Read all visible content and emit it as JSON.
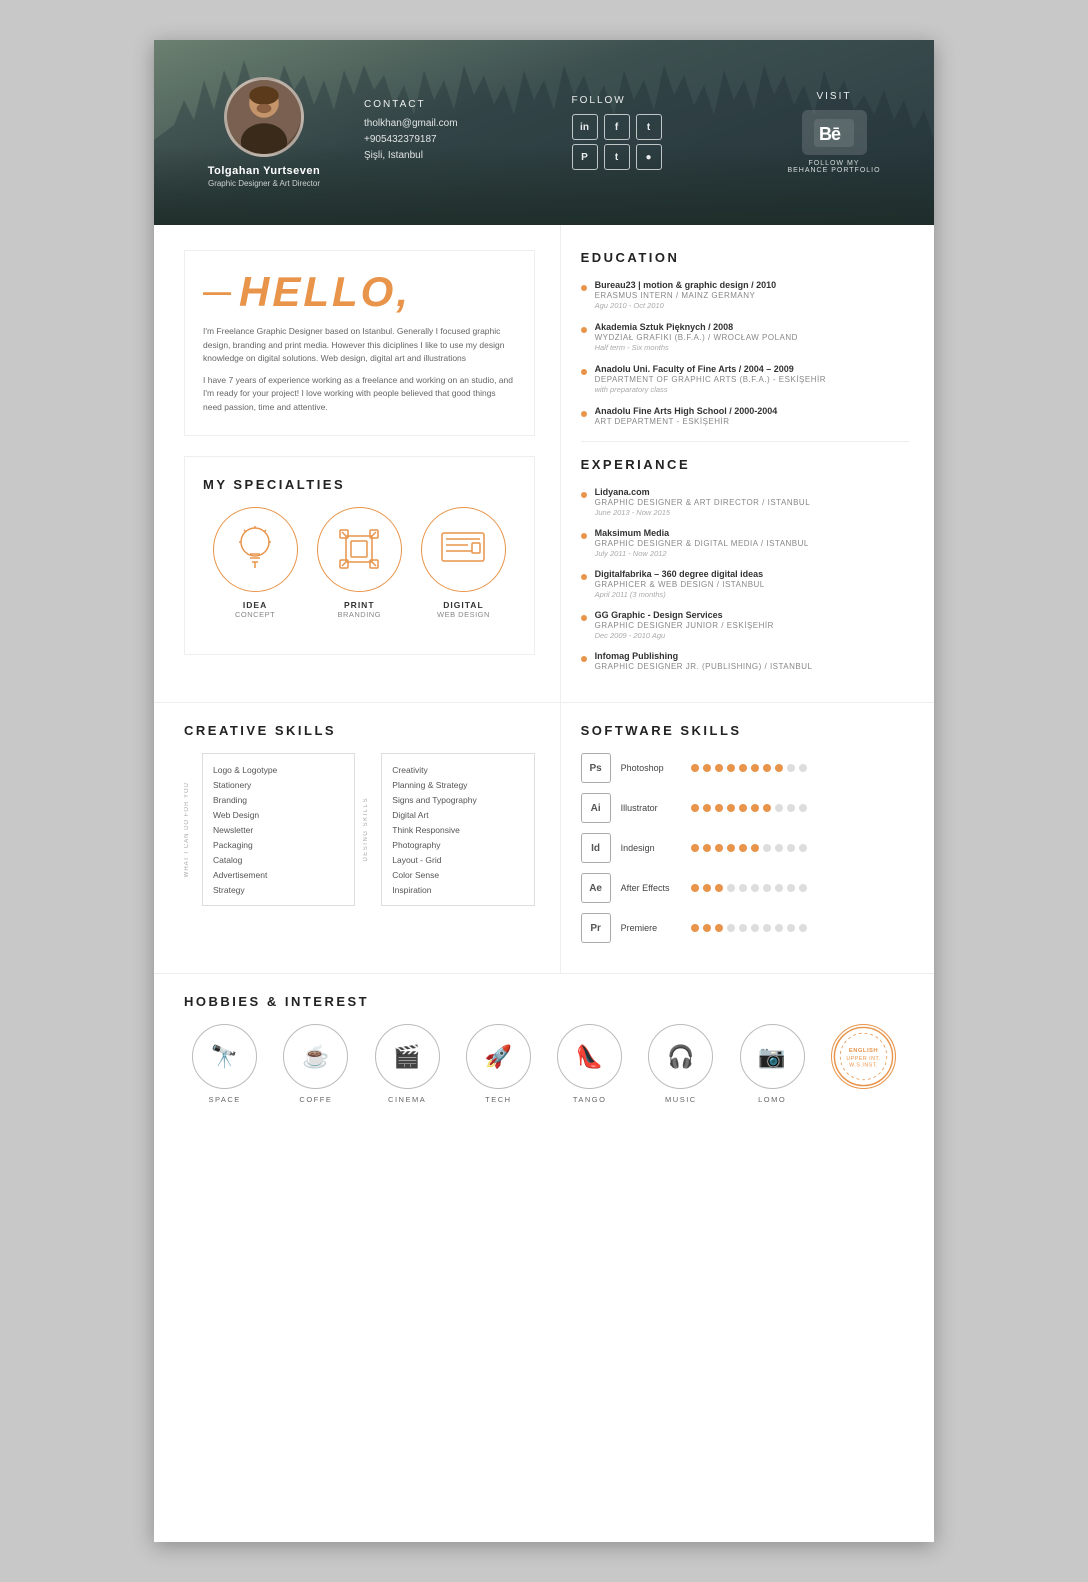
{
  "header": {
    "name": "Tolgahan Yurtseven",
    "title": "Graphic Designer & Art Director",
    "contact_label": "Contact",
    "email": "tholkhan@gmail.com",
    "phone": "+905432379187",
    "location": "Şişli, Istanbul",
    "follow_label": "Follow",
    "visit_label": "Visit",
    "behance_text": "FOLLOW MY\nBEHANCE PORTFOLIO",
    "social": [
      "in",
      "f",
      "t",
      "P",
      "t",
      "📷"
    ]
  },
  "hello": {
    "greeting": "HELLO,",
    "dash": "—",
    "bio1": "I'm Freelance Graphic Designer based on Istanbul. Generally I focused graphic design, branding and print media. However this diciplines I like to use my design knowledge on digital solutions. Web design, digital art and illustrations",
    "bio2": "I have 7 years of experience working as a freelance and working on an studio, and I'm ready for your project! I love working with people believed that good things need passion, time and attentive."
  },
  "specialties": {
    "title": "MY SPECIALTIES",
    "items": [
      {
        "icon": "💡",
        "label": "IDEA",
        "sub": "CONCEPT"
      },
      {
        "icon": "🖨",
        "label": "PRINT",
        "sub": "BRANDING"
      },
      {
        "icon": "🖥",
        "label": "DIGITAL",
        "sub": "WEB DESIGN"
      }
    ]
  },
  "education": {
    "title": "EDUCATION",
    "items": [
      {
        "title": "Bureau23 | motion & graphic design / 2010",
        "sub": "ERASMUS INTERN / MAINZ GERMANY",
        "date": "Agu 2010 - Oct 2010"
      },
      {
        "title": "Akademia Sztuk Pięknych / 2008",
        "sub": "WYDZIAŁ GRAFIKI (B.F.A.) / WROCŁAW POLAND",
        "date": "Half term - Six months"
      },
      {
        "title": "Anadolu Uni. Faculty of Fine Arts / 2004 – 2009",
        "sub": "DEPARTMENT OF GRAPHIC ARTS (B.F.A.) - ESKİŞEHİR",
        "date": "with preparatory class"
      },
      {
        "title": "Anadolu Fine Arts High School / 2000-2004",
        "sub": "ART DEPARTMENT - ESKİŞEHİR",
        "date": ""
      }
    ]
  },
  "experience": {
    "title": "EXPERIANCE",
    "items": [
      {
        "title": "Lidyana.com",
        "sub": "GRAPHIC DESIGNER & ART DIRECTOR / ISTANBUL",
        "date": "June 2013 - Now 2015"
      },
      {
        "title": "Maksimum Media",
        "sub": "GRAPHIC DESIGNER & DIGITAL MEDIA / ISTANBUL",
        "date": "July 2011 - Now 2012"
      },
      {
        "title": "Digitalfabrika – 360 degree digital ideas",
        "sub": "GRAPHICER & WEB DESIGN / ISTANBUL",
        "date": "April 2011 (3 months)"
      },
      {
        "title": "GG Graphic - Design Services",
        "sub": "GRAPHIC DESIGNER JUNIOR / ESKİŞEHİR",
        "date": "Dec 2009 - 2010 Agu"
      },
      {
        "title": "Infomag Publishing",
        "sub": "GRAPHIC DESIGNER JR. (PUBLISHING) / ISTANBUL",
        "date": ""
      }
    ]
  },
  "creative_skills": {
    "title": "CREATIVE SKILLS",
    "what_i_can_label": "WHAT I CAN DO FOR YOU",
    "design_skills_label": "DESING SKILLS",
    "col1": [
      "Logo & Logotype",
      "Stationery",
      "Branding",
      "Web Design",
      "Newsletter",
      "Packaging",
      "Catalog",
      "Advertisement",
      "Strategy"
    ],
    "col2": [
      "Creativity",
      "Planning & Strategy",
      "Signs and Typography",
      "Digital Art",
      "Think Responsive",
      "Photography",
      "Layout - Grid",
      "Color Sense",
      "Inspiration"
    ]
  },
  "software_skills": {
    "title": "SOFTWARE SKILLS",
    "items": [
      {
        "name": "Photoshop",
        "abbr": "Ps",
        "filled": 8,
        "empty": 2
      },
      {
        "name": "Illustrator",
        "abbr": "Ai",
        "filled": 7,
        "empty": 3
      },
      {
        "name": "Indesign",
        "abbr": "Id",
        "filled": 6,
        "empty": 4
      },
      {
        "name": "After Effects",
        "abbr": "Ae",
        "filled": 3,
        "empty": 7
      },
      {
        "name": "Premiere",
        "abbr": "Pr",
        "filled": 3,
        "empty": 7
      }
    ]
  },
  "hobbies": {
    "title": "HOBBIES & INTEREST",
    "items": [
      {
        "icon": "🔭",
        "label": "SPACE"
      },
      {
        "icon": "☕",
        "label": "COFFE"
      },
      {
        "icon": "🎬",
        "label": "CINEMA"
      },
      {
        "icon": "🚀",
        "label": "TECH"
      },
      {
        "icon": "👠",
        "label": "TANGO"
      },
      {
        "icon": "🎧",
        "label": "MUSIC"
      },
      {
        "icon": "📷",
        "label": "LOMO"
      },
      {
        "english": true,
        "label": "ENGLISH\nUPPER INT.\nW.S.INST."
      }
    ]
  }
}
